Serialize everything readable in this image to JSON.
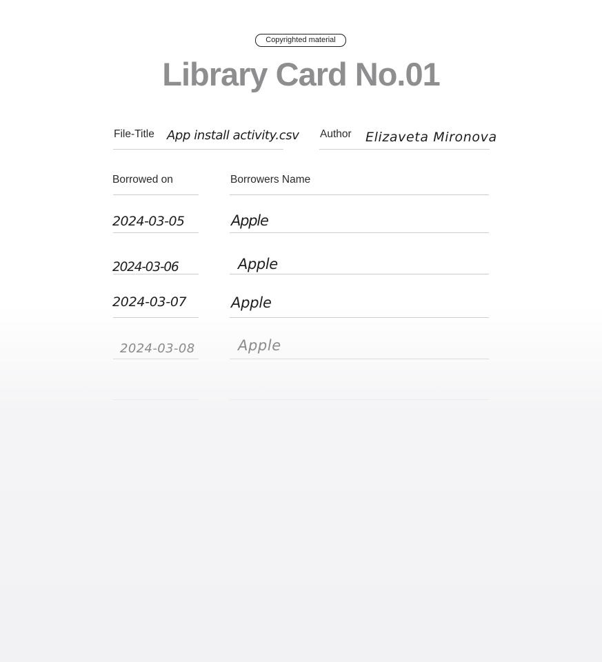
{
  "badge": "Copyrighted material",
  "title": "Library Card No.01",
  "header": {
    "file_title_label": "File-Title",
    "file_title_value": "App install activity.csv",
    "author_label": "Author",
    "author_value": "Elizaveta Mironova"
  },
  "columns": {
    "borrowed_on": "Borrowed on",
    "borrowers_name": "Borrowers Name"
  },
  "rows": [
    {
      "date": "2024-03-05",
      "name": "Apple"
    },
    {
      "date": "2024-03-06",
      "name": "Apple"
    },
    {
      "date": "2024-03-07",
      "name": "Apple"
    },
    {
      "date": "2024-03-08",
      "name": "Apple"
    }
  ]
}
